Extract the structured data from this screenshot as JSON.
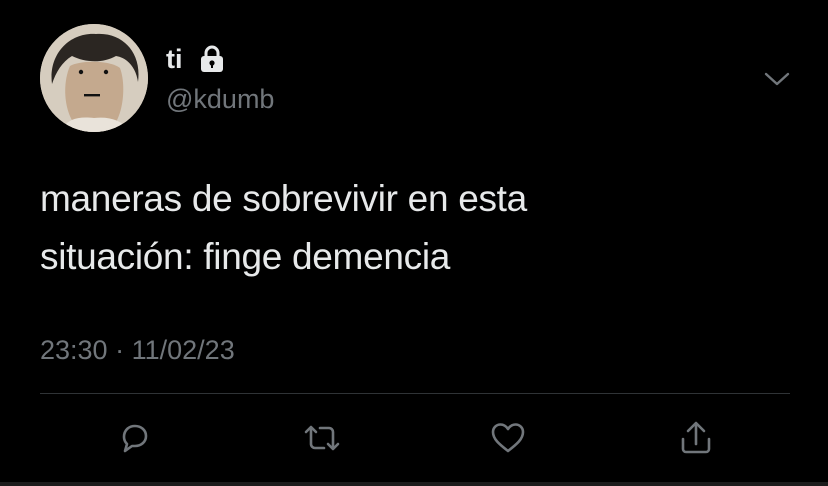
{
  "user": {
    "display_name": "ti",
    "handle": "@kdumb",
    "avatar_icon": "avatar-drawn-face",
    "protected_icon": "lock-icon"
  },
  "tweet": {
    "lines": [
      "maneras de sobrevivir en esta",
      "situación: finge demencia"
    ],
    "time": "23:30",
    "separator": "·",
    "date": "11/02/23"
  },
  "actions": [
    {
      "name": "reply",
      "icon": "reply-icon"
    },
    {
      "name": "retweet",
      "icon": "retweet-icon"
    },
    {
      "name": "like",
      "icon": "heart-icon"
    },
    {
      "name": "share",
      "icon": "share-icon"
    }
  ],
  "colors": {
    "background": "#000000",
    "primary_text": "#e7e9ea",
    "secondary_text": "#71767b",
    "divider": "#2f3336"
  }
}
